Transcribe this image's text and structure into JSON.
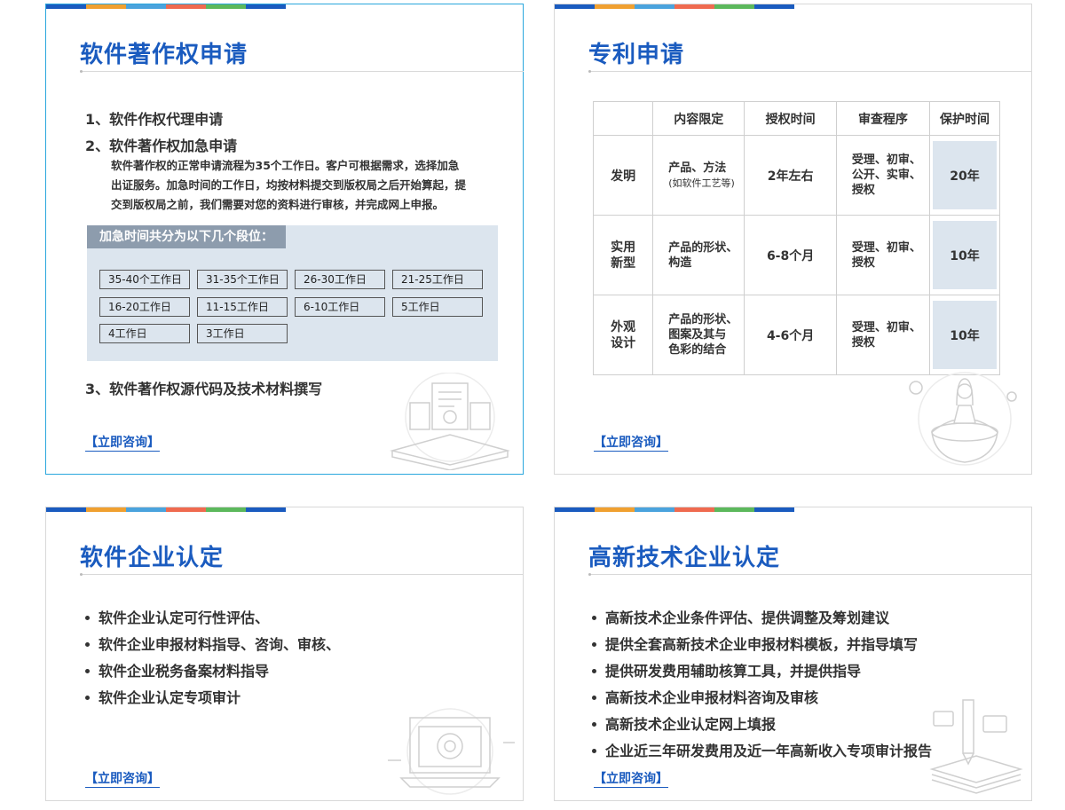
{
  "stripe_colors": [
    "#1a5bbf",
    "#f0a030",
    "#4aa3dd",
    "#ef6a4f",
    "#5cb85c",
    "#1a5bbf"
  ],
  "cards": {
    "software_copyright": {
      "title": "软件著作权申请",
      "items": [
        "1、软件作权代理申请",
        "2、软件著作权加急申请",
        "3、软件著作权源代码及技术材料撰写"
      ],
      "paragraph_lines": [
        "软件著作权的正常申请流程为35个工作日。客户可根据需求，选择加急",
        "出证服务。加急时间的工作日，均按材料提交到版权局之后开始算起，提",
        "交到版权局之前，我们需要对您的资料进行审核，并完成网上申报。"
      ],
      "segments_header": "加急时间共分为以下几个段位：",
      "segments": [
        "35-40个工作日",
        "31-35个工作日",
        "26-30工作日",
        "21-25工作日",
        "16-20工作日",
        "11-15工作日",
        "6-10工作日",
        "5工作日",
        "4工作日",
        "3工作日"
      ],
      "consult_label": "【立即咨询】"
    },
    "patent": {
      "title": "专利申请",
      "table": {
        "headers": [
          "",
          "内容限定",
          "授权时间",
          "审查程序",
          "保护时间"
        ],
        "rows": [
          {
            "type": "发明",
            "content": "产品、方法",
            "content_note": "(如软件工艺等)",
            "time": "2年左右",
            "procedure_lines": [
              "受理、初审、",
              "公开、实审、",
              "授权"
            ],
            "protection": "20年"
          },
          {
            "type_lines": [
              "实用",
              "新型"
            ],
            "content_lines": [
              "产品的形状、",
              "构造"
            ],
            "time": "6-8个月",
            "procedure_lines": [
              "受理、初审、",
              "授权"
            ],
            "protection": "10年"
          },
          {
            "type_lines": [
              "外观",
              "设计"
            ],
            "content_lines": [
              "产品的形状、",
              "图案及其与",
              "色彩的结合"
            ],
            "time": "4-6个月",
            "procedure_lines": [
              "受理、初审、",
              "授权"
            ],
            "protection": "10年"
          }
        ]
      },
      "consult_label": "【立即咨询】"
    },
    "software_enterprise": {
      "title": "软件企业认定",
      "bullets": [
        "软件企业认定可行性评估、",
        "软件企业申报材料指导、咨询、审核、",
        "软件企业税务备案材料指导",
        "软件企业认定专项审计"
      ],
      "consult_label": "【立即咨询】"
    },
    "high_tech": {
      "title": "高新技术企业认定",
      "bullets": [
        "高新技术企业条件评估、提供调整及筹划建议",
        "提供全套高新技术企业申报材料模板，并指导填写",
        "提供研发费用辅助核算工具，并提供指导",
        "高新技术企业申报材料咨询及审核",
        "高新技术企业认定网上填报",
        "企业近三年研发费用及近一年高新收入专项审计报告"
      ],
      "consult_label": "【立即咨询】"
    }
  }
}
